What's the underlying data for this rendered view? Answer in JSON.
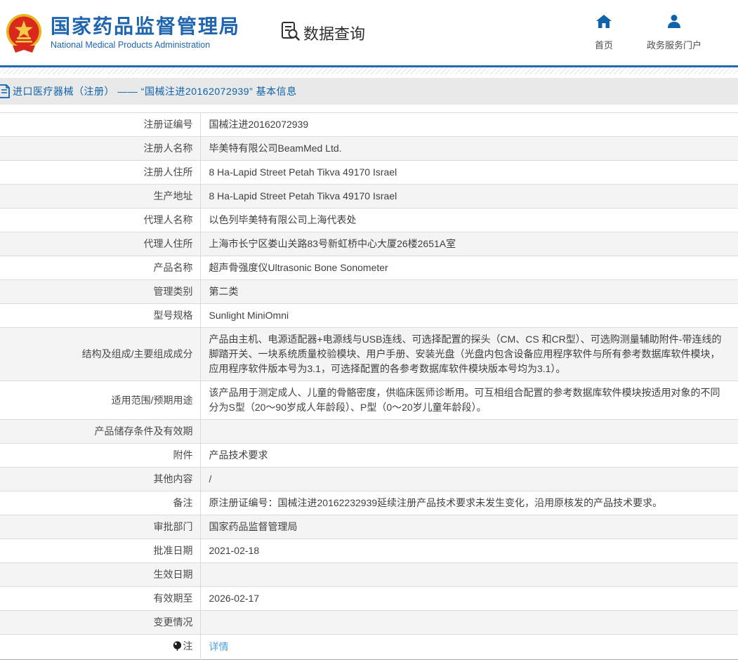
{
  "colors": {
    "accent_blue": "#2065b0",
    "header_line": "#1e6bb0",
    "link_blue": "#4b9fe8",
    "breadcrumb_bg": "#e9e9e9",
    "alt_row_bg": "#f4f4f4"
  },
  "icons": {
    "emblem": "china-national-emblem",
    "data_query": "document-magnifier-icon",
    "home": "home-icon",
    "portal": "person-icon",
    "breadcrumb": "document-icon",
    "note": "balloon-note-icon"
  },
  "header": {
    "title_cn": "国家药品监督管理局",
    "title_en": "National Medical Products Administration",
    "data_query_label": "数据查询",
    "home_label": "首页",
    "portal_label": "政务服务门户"
  },
  "breadcrumb": {
    "text": "进口医疗器械（注册） —— “国械注进20162072939” 基本信息"
  },
  "table": {
    "rows": [
      {
        "label": "注册证编号",
        "value": "国械注进20162072939"
      },
      {
        "label": "注册人名称",
        "value": "毕美特有限公司BeamMed Ltd."
      },
      {
        "label": "注册人住所",
        "value": "8 Ha-Lapid Street Petah Tikva 49170 Israel"
      },
      {
        "label": "生产地址",
        "value": "8 Ha-Lapid Street Petah Tikva 49170 Israel"
      },
      {
        "label": "代理人名称",
        "value": "以色列毕美特有限公司上海代表处"
      },
      {
        "label": "代理人住所",
        "value": "上海市长宁区娄山关路83号新虹桥中心大厦26楼2651A室"
      },
      {
        "label": "产品名称",
        "value": "超声骨强度仪Ultrasonic Bone Sonometer"
      },
      {
        "label": "管理类别",
        "value": "第二类"
      },
      {
        "label": "型号规格",
        "value": "Sunlight MiniOmni"
      },
      {
        "label": "结构及组成/主要组成成分",
        "value": "产品由主机、电源适配器+电源线与USB连线、可选择配置的探头（CM、CS 和CR型）、可选购测量辅助附件-带连线的脚踏开关、一块系统质量校验模块、用户手册、安装光盘（光盘内包含设备应用程序软件与所有参考数据库软件模块，应用程序软件版本号为3.1，可选择配置的各参考数据库软件模块版本号均为3.1）。",
        "tall": true
      },
      {
        "label": "适用范围/预期用途",
        "value": "该产品用于测定成人、儿童的骨骼密度，供临床医师诊断用。可互相组合配置的参考数据库软件模块按适用对象的不同分为S型（20～90岁成人年龄段）、P型（0～20岁儿童年龄段）。",
        "tall": true
      },
      {
        "label": "产品储存条件及有效期",
        "value": ""
      },
      {
        "label": "附件",
        "value": "产品技术要求"
      },
      {
        "label": "其他内容",
        "value": "/"
      },
      {
        "label": "备注",
        "value": "原注册证编号：国械注进20162232939延续注册产品技术要求未发生变化，沿用原核发的产品技术要求。"
      },
      {
        "label": "审批部门",
        "value": "国家药品监督管理局"
      },
      {
        "label": "批准日期",
        "value": "2021-02-18"
      },
      {
        "label": "生效日期",
        "value": ""
      },
      {
        "label": "有效期至",
        "value": "2026-02-17"
      },
      {
        "label": "变更情况",
        "value": ""
      },
      {
        "label": "注",
        "value": "详情",
        "link": true,
        "note_icon": true
      }
    ]
  }
}
